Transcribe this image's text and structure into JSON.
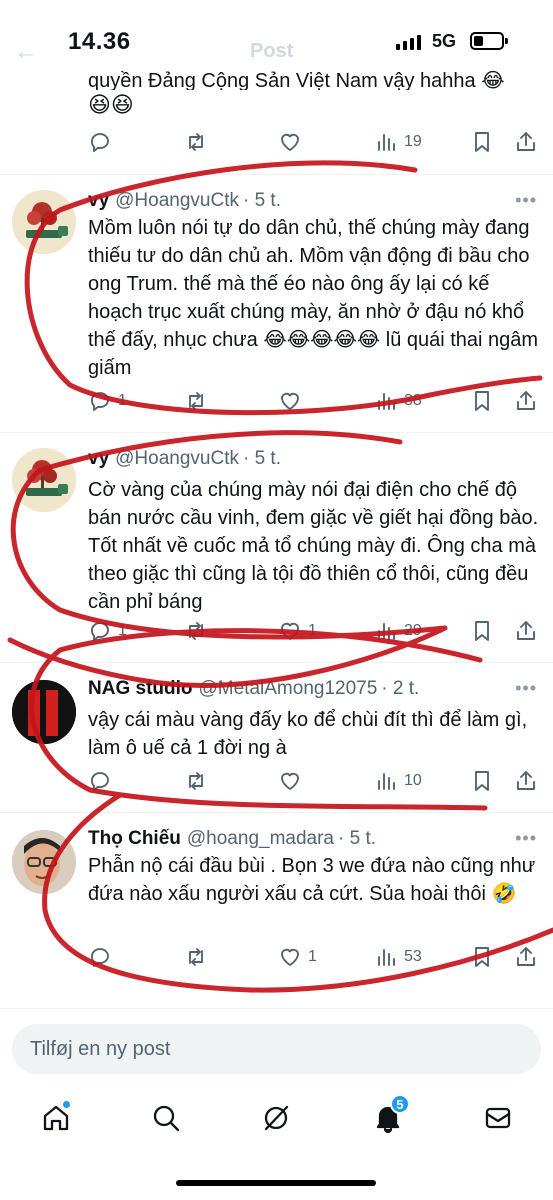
{
  "status_bar": {
    "time": "14.36",
    "network": "5G"
  },
  "header": {
    "title": "Post"
  },
  "previous_tweet": {
    "text_partial": "quyền Đảng Cộng Sản Việt Nam vậy hahha 😂",
    "emojis": "😆😆",
    "views": "19"
  },
  "tweets": [
    {
      "name": "vy",
      "handle": "@HoangvuCtk",
      "time": "· 5 t.",
      "text": "Mồm luôn nói tự do dân chủ, thế chúng mày đang thiếu tư do dân chủ ah. Mồm vận động đi bầu cho ong Trum. thế mà thế éo nào ông ấy lại có kế hoạch trục xuất chúng mày, ăn nhờ ở đậu nó khổ thế đấy, nhục chưa 😂😂😂😂😂 lũ quái thai ngâm giấm",
      "replies": "1",
      "reposts": "",
      "likes": "",
      "views": "38",
      "avatar_icon": "bonsai-tree-avatar"
    },
    {
      "name": "vy",
      "handle": "@HoangvuCtk",
      "time": "· 5 t.",
      "text": "Cờ vàng của chúng mày nói đại điện cho chế độ bán nước cầu vinh, đem giặc về giết hại đồng bào. Tốt nhất về cuốc mả tổ chúng mày đi. Ông cha mà theo giặc thì cũng là tội đồ thiên cổ thôi, cũng đều cần phỉ báng",
      "replies": "1",
      "reposts": "",
      "likes": "1",
      "views": "29",
      "avatar_icon": "bonsai-tree-avatar"
    },
    {
      "name": "NAG studio",
      "handle": "@MetalAmong12075",
      "time": "· 2 t.",
      "text": "vậy cái màu vàng đấy ko để chùi đít thì để làm gì, làm ô uế cả 1 đời ng à",
      "replies": "",
      "reposts": "",
      "likes": "",
      "views": "10",
      "avatar_icon": "red-bars-avatar"
    },
    {
      "name": "Thọ Chiếu",
      "handle": "@hoang_madara",
      "time": "· 5 t.",
      "text": "Phẫn nộ cái đầu bùi . Bọn 3 we đứa nào cũng như đứa nào xấu người xấu cả cứt. Sủa hoài thôi 🤣",
      "replies": "",
      "reposts": "",
      "likes": "1",
      "views": "53",
      "avatar_icon": "person-photo-avatar"
    }
  ],
  "compose": {
    "placeholder": "Tilføj en ny post"
  },
  "nav": {
    "items": [
      "home-icon",
      "search-icon",
      "grok-icon",
      "notifications-icon",
      "messages-icon"
    ],
    "notifications_count": "5"
  },
  "colors": {
    "accent": "#1d9bf0",
    "scribble": "#c4141b",
    "muted": "#536471"
  }
}
